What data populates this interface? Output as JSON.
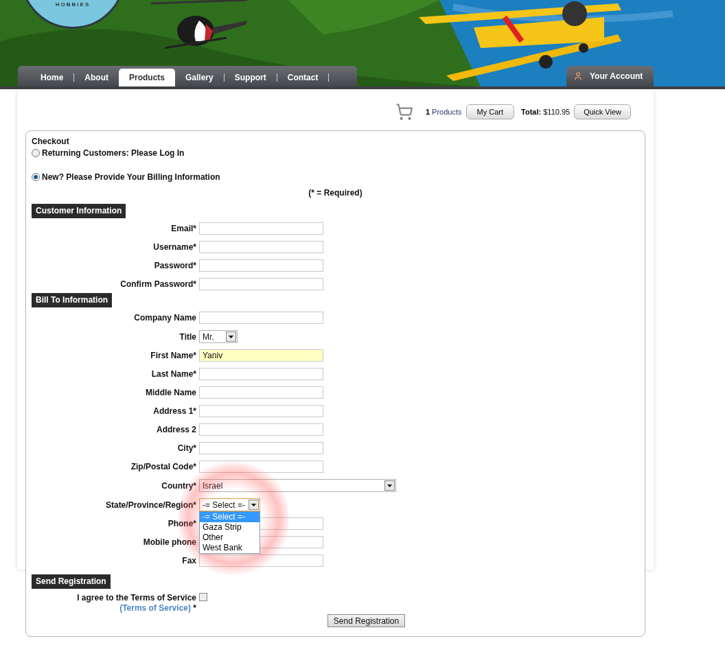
{
  "header": {
    "logo_text": "HOBBIES",
    "nav": [
      {
        "label": "Home",
        "selected": false
      },
      {
        "label": "About",
        "selected": false
      },
      {
        "label": "Products",
        "selected": true
      },
      {
        "label": "Gallery",
        "selected": false
      },
      {
        "label": "Support",
        "selected": false
      },
      {
        "label": "Contact",
        "selected": false
      }
    ],
    "account": "Your Account"
  },
  "cart": {
    "count": "1",
    "count_label": "Products",
    "my_cart": "My Cart",
    "total_label": "Total:",
    "total": "$110.95",
    "quick_view": "Quick View"
  },
  "checkout": {
    "title": "Checkout",
    "options": [
      {
        "label": "Returning Customers: Please Log In",
        "selected": false
      },
      {
        "label": "New? Please Provide Your Billing Information",
        "selected": true
      }
    ],
    "required_note": "(* = Required)",
    "sections": [
      {
        "title": "Customer Information",
        "fields": [
          {
            "label": "Email*",
            "kind": "text"
          },
          {
            "label": "Username*",
            "kind": "text"
          },
          {
            "label": "Password*",
            "kind": "text"
          },
          {
            "label": "Confirm Password*",
            "kind": "text"
          }
        ]
      },
      {
        "title": "Bill To Information",
        "fields": [
          {
            "label": "Company Name",
            "kind": "text"
          },
          {
            "label": "Title",
            "kind": "select",
            "value": "Mr."
          },
          {
            "label": "First Name*",
            "kind": "text",
            "value": "Yaniv",
            "highlighted": true
          },
          {
            "label": "Last Name*",
            "kind": "text"
          },
          {
            "label": "Middle Name",
            "kind": "text"
          },
          {
            "label": "Address 1*",
            "kind": "text"
          },
          {
            "label": "Address 2",
            "kind": "text"
          },
          {
            "label": "City*",
            "kind": "text"
          },
          {
            "label": "Zip/Postal Code*",
            "kind": "text"
          },
          {
            "label": "Country*",
            "kind": "wide-select",
            "value": "Israel"
          },
          {
            "label": "State/Province/Region*",
            "kind": "select",
            "value": "-= Select =-",
            "open": true,
            "options": [
              {
                "label": "-= Select =-",
                "selected": true
              },
              {
                "label": "Gaza Strip",
                "selected": false
              },
              {
                "label": "Other",
                "selected": false
              },
              {
                "label": "West Bank",
                "selected": false
              }
            ]
          },
          {
            "label": "Phone*",
            "kind": "text"
          },
          {
            "label": "Mobile phone",
            "kind": "text"
          },
          {
            "label": "Fax",
            "kind": "text"
          }
        ]
      }
    ],
    "send": {
      "title": "Send Registration",
      "terms_text": "I agree to the Terms of Service",
      "terms_link": "(Terms of Service)",
      "terms_suffix": "*",
      "agreed": false,
      "button": "Send Registration"
    }
  }
}
